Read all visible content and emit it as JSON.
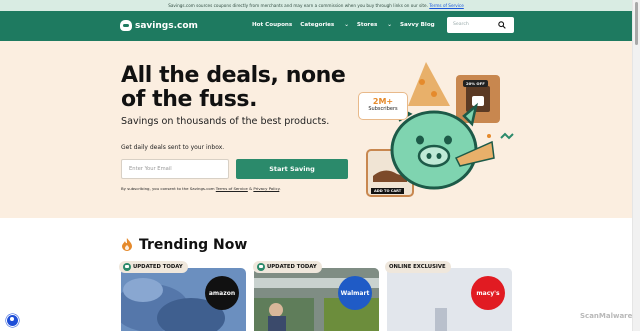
{
  "disclaimer": {
    "text": "Savings.com sources coupons directly from merchants and may earn a commission when you buy through links on our site.",
    "link": "Terms of Service"
  },
  "brand": {
    "name": "savings.com",
    "primary": "#1e7a60",
    "accent": "#2b8a6b",
    "hero_bg": "#fbeee0"
  },
  "nav": {
    "items": [
      {
        "label": "Hot Coupons"
      },
      {
        "label": "Categories",
        "icon": "chevron-down-icon"
      },
      {
        "label": "Stores",
        "icon": "chevron-down-icon"
      },
      {
        "label": "Savvy Blog"
      }
    ],
    "search_placeholder": "Search"
  },
  "hero": {
    "title": "All the deals, none of the fuss.",
    "subtitle": "Savings on thousands of the best products.",
    "daily_text": "Get daily deals sent to your inbox.",
    "email_placeholder": "Enter Your Email",
    "button": "Start Saving",
    "consent": {
      "prefix": "By subscribing, you consent to the Savings.com",
      "terms": "Terms of Service",
      "and": "&",
      "privacy": "Privacy Policy"
    },
    "badge": {
      "number": "2M+",
      "label": "Subscribers"
    },
    "coupon": "20% OFF",
    "cart": "ADD TO CART"
  },
  "trending": {
    "title": "Trending Now",
    "cards": [
      {
        "tag": "UPDATED TODAY",
        "store": "amazon"
      },
      {
        "tag": "UPDATED TODAY",
        "store": "Walmart"
      },
      {
        "tag": "ONLINE EXCLUSIVE",
        "store": "macy's"
      }
    ]
  },
  "watermark": "ScanMalware"
}
